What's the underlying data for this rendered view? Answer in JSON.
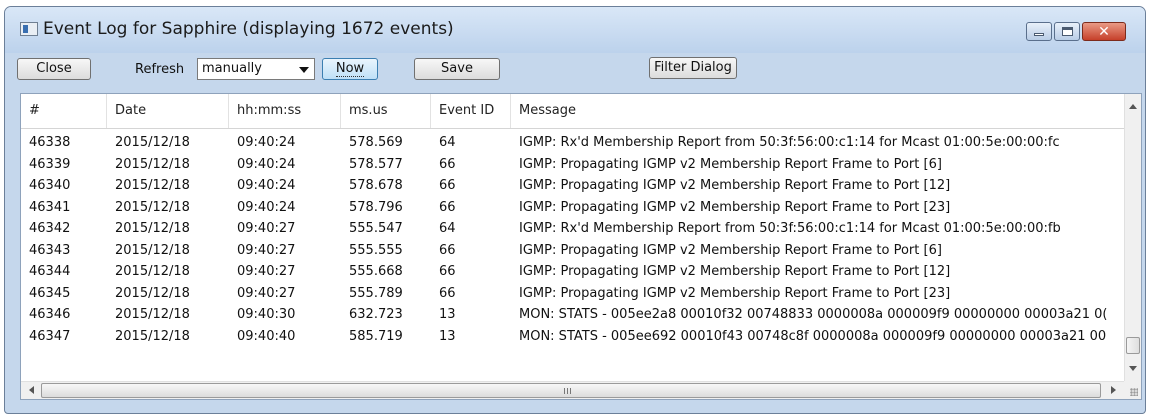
{
  "window": {
    "title": "Event Log for Sapphire (displaying 1672 events)"
  },
  "toolbar": {
    "close_label": "Close",
    "refresh_label": "Refresh",
    "refresh_value": "manually",
    "now_label": "Now",
    "save_label": "Save",
    "filter_label": "Filter Dialog"
  },
  "table": {
    "columns": [
      "#",
      "Date",
      "hh:mm:ss",
      "ms.us",
      "Event ID",
      "Message"
    ],
    "rows": [
      [
        "46338",
        "2015/12/18",
        "09:40:24",
        "578.569",
        "64",
        "IGMP: Rx'd Membership Report from 50:3f:56:00:c1:14 for Mcast 01:00:5e:00:00:fc"
      ],
      [
        "46339",
        "2015/12/18",
        "09:40:24",
        "578.577",
        "66",
        "IGMP: Propagating IGMP v2 Membership Report Frame to Port [6]"
      ],
      [
        "46340",
        "2015/12/18",
        "09:40:24",
        "578.678",
        "66",
        "IGMP: Propagating IGMP v2 Membership Report Frame to Port [12]"
      ],
      [
        "46341",
        "2015/12/18",
        "09:40:24",
        "578.796",
        "66",
        "IGMP: Propagating IGMP v2 Membership Report Frame to Port [23]"
      ],
      [
        "46342",
        "2015/12/18",
        "09:40:27",
        "555.547",
        "64",
        "IGMP: Rx'd Membership Report from 50:3f:56:00:c1:14 for Mcast 01:00:5e:00:00:fb"
      ],
      [
        "46343",
        "2015/12/18",
        "09:40:27",
        "555.555",
        "66",
        "IGMP: Propagating IGMP v2 Membership Report Frame to Port [6]"
      ],
      [
        "46344",
        "2015/12/18",
        "09:40:27",
        "555.668",
        "66",
        "IGMP: Propagating IGMP v2 Membership Report Frame to Port [12]"
      ],
      [
        "46345",
        "2015/12/18",
        "09:40:27",
        "555.789",
        "66",
        "IGMP: Propagating IGMP v2 Membership Report Frame to Port [23]"
      ],
      [
        "46346",
        "2015/12/18",
        "09:40:30",
        "632.723",
        "13",
        "MON: STATS - 005ee2a8 00010f32 00748833 0000008a 000009f9 00000000 00003a21 0("
      ],
      [
        "46347",
        "2015/12/18",
        "09:40:40",
        "585.719",
        "13",
        "MON: STATS - 005ee692 00010f43 00748c8f 0000008a 000009f9 00000000 00003a21 00"
      ]
    ],
    "vertical_scroll_fraction": 0.97,
    "horizontal_scroll_fraction": 0.0
  },
  "colors": {
    "window_frame": "#c5d7ec",
    "close_button": "#c6402a",
    "now_button": "#bfe0f7"
  }
}
